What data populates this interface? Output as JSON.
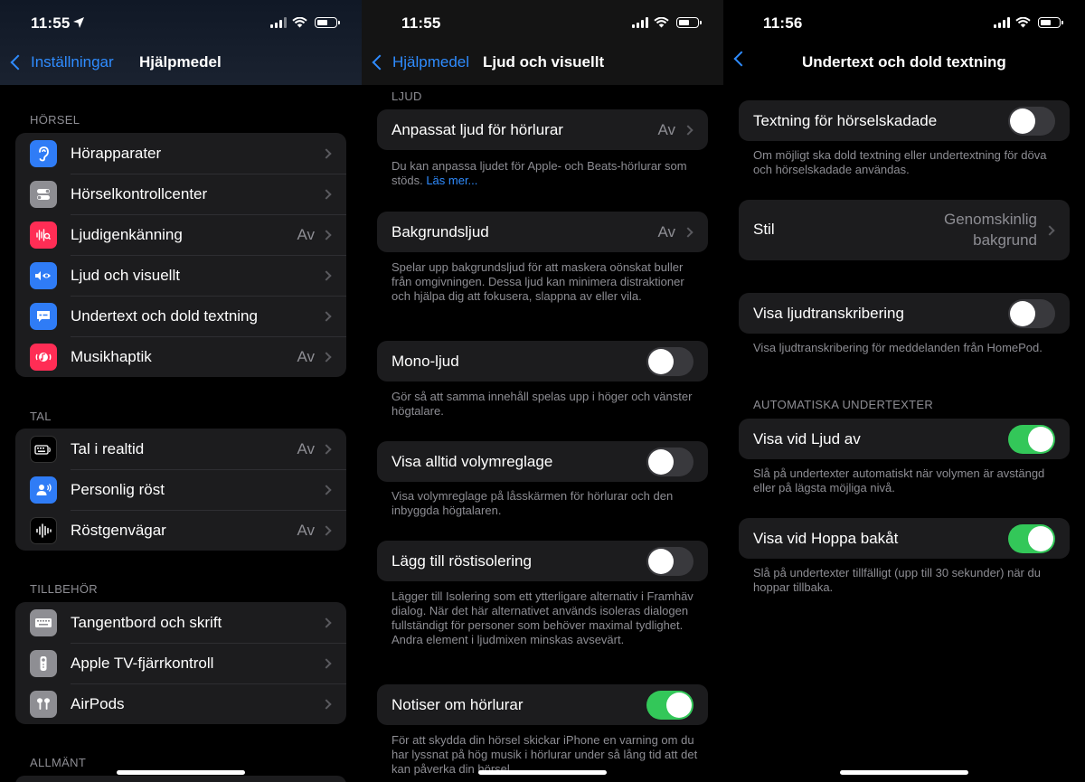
{
  "panel1": {
    "time": "11:55",
    "back": "Inställningar",
    "title": "Hjälpmedel",
    "sections": [
      {
        "header": "HÖRSEL",
        "items": [
          {
            "label": "Hörapparater",
            "value": "",
            "icon": "ear-icon",
            "color": "#2f7cf6"
          },
          {
            "label": "Hörselkontrollcenter",
            "value": "",
            "icon": "toggles-icon",
            "color": "#8e8e93"
          },
          {
            "label": "Ljudigenkänning",
            "value": "Av",
            "icon": "waveform-search-icon",
            "color": "#ff2d55"
          },
          {
            "label": "Ljud och visuellt",
            "value": "",
            "icon": "eye-speaker-icon",
            "color": "#2f7cf6"
          },
          {
            "label": "Undertext och dold textning",
            "value": "",
            "icon": "caption-bubble-icon",
            "color": "#2f7cf6"
          },
          {
            "label": "Musikhaptik",
            "value": "Av",
            "icon": "music-haptic-icon",
            "color": "#ff2d55"
          }
        ]
      },
      {
        "header": "TAL",
        "items": [
          {
            "label": "Tal i realtid",
            "value": "Av",
            "icon": "keyboard-speech-icon",
            "color": "#000000"
          },
          {
            "label": "Personlig röst",
            "value": "",
            "icon": "person-voice-icon",
            "color": "#2f7cf6"
          },
          {
            "label": "Röstgenvägar",
            "value": "Av",
            "icon": "waveform-icon",
            "color": "#000000"
          }
        ]
      },
      {
        "header": "TILLBEHÖR",
        "items": [
          {
            "label": "Tangentbord och skrift",
            "value": "",
            "icon": "keyboard-icon",
            "color": "#8e8e93"
          },
          {
            "label": "Apple TV-fjärrkontroll",
            "value": "",
            "icon": "remote-icon",
            "color": "#8e8e93"
          },
          {
            "label": "AirPods",
            "value": "",
            "icon": "airpods-icon",
            "color": "#8e8e93"
          }
        ]
      },
      {
        "header": "ALLMÄNT",
        "items": []
      }
    ]
  },
  "panel2": {
    "time": "11:55",
    "back": "Hjälpmedel",
    "title": "Ljud och visuellt",
    "section_header": "LJUD",
    "items": [
      {
        "label": "Anpassat ljud för hörlurar",
        "value": "Av",
        "footer": "Du kan anpassa ljudet för Apple- och Beats-hörlurar som stöds.",
        "link": "Läs mer..."
      },
      {
        "label": "Bakgrundsljud",
        "value": "Av",
        "footer": "Spelar upp bakgrundsljud för att maskera oönskat buller från omgivningen. Dessa ljud kan minimera distraktioner och hjälpa dig att fokusera, slappna av eller vila."
      },
      {
        "label": "Mono-ljud",
        "toggle": false,
        "footer": "Gör så att samma innehåll spelas upp i höger och vänster högtalare."
      },
      {
        "label": "Visa alltid volymreglage",
        "toggle": false,
        "footer": "Visa volymreglage på låsskärmen för hörlurar och den inbyggda högtalaren."
      },
      {
        "label": "Lägg till röstisolering",
        "toggle": false,
        "footer": "Lägger till Isolering som ett ytterligare alternativ i Framhäv dialog. När det här alternativet används isoleras dialogen fullständigt för personer som behöver maximal tydlighet. Andra element i ljudmixen minskas avsevärt."
      },
      {
        "label": "Notiser om hörlurar",
        "toggle": true,
        "footer": "För att skydda din hörsel skickar iPhone en varning om du har lyssnat på hög musik i hörlurar under så lång tid att det kan påverka din hörsel."
      }
    ]
  },
  "panel3": {
    "time": "11:56",
    "title": "Undertext och dold textning",
    "items": [
      {
        "label": "Textning för hörselskadade",
        "toggle": false,
        "footer": "Om möjligt ska dold textning eller undertextning för döva och hörselskadade användas."
      },
      {
        "label": "Stil",
        "value": "Genomskinlig bakgrund"
      },
      {
        "label": "Visa ljudtranskribering",
        "toggle": false,
        "footer": "Visa ljudtranskribering för meddelanden från HomePod."
      },
      {
        "label": "Visa vid Ljud av",
        "toggle": true,
        "footer": "Slå på undertexter automatiskt när volymen är avstängd eller på lägsta möjliga nivå."
      },
      {
        "label": "Visa vid Hoppa bakåt",
        "toggle": true,
        "footer": "Slå på undertexter tillfälligt (upp till 30 sekunder) när du hoppar tillbaka."
      }
    ],
    "section_header": "AUTOMATISKA UNDERTEXTER"
  },
  "colors": {
    "accent": "#2f8cff",
    "toggle_on": "#33c759",
    "cell_bg": "#1c1c1e",
    "secondary_text": "#8d8d93"
  }
}
